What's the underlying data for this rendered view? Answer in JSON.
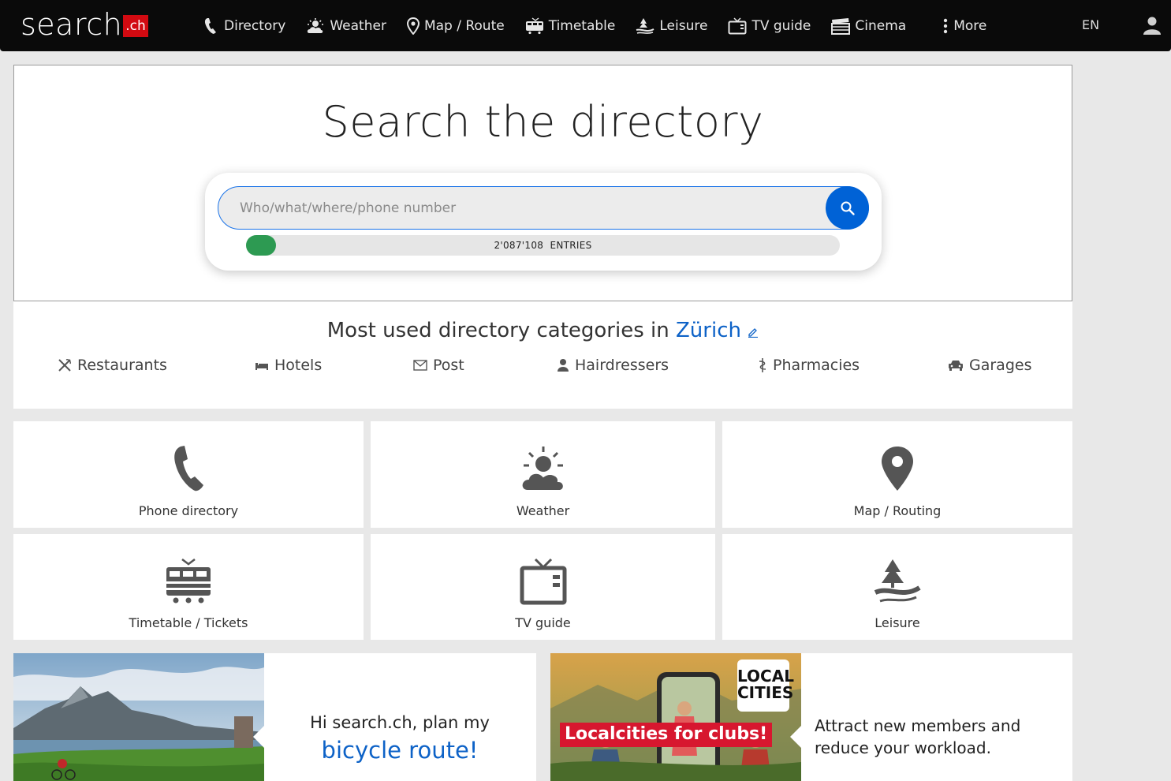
{
  "header": {
    "logo_text": "search",
    "logo_suffix": ".ch",
    "nav": [
      {
        "label": "Directory",
        "icon": "phone-icon"
      },
      {
        "label": "Weather",
        "icon": "weather-icon"
      },
      {
        "label": "Map / Route",
        "icon": "map-pin-icon"
      },
      {
        "label": "Timetable",
        "icon": "train-icon"
      },
      {
        "label": "Leisure",
        "icon": "leisure-icon"
      },
      {
        "label": "TV guide",
        "icon": "tv-icon"
      },
      {
        "label": "Cinema",
        "icon": "clapper-icon"
      },
      {
        "label": "More",
        "icon": "more-dots-icon"
      }
    ],
    "language": "EN",
    "user_icon": "user-icon"
  },
  "hero": {
    "title": "Search the directory",
    "search_placeholder": "Who/what/where/phone number",
    "entries_count": "2'087'108",
    "entries_label": "ENTRIES",
    "progress_fraction": 0.05,
    "accent_color": "#0062d6",
    "progress_color": "#2d9a52"
  },
  "categories": {
    "title_prefix": "Most used directory categories in",
    "city": "Zürich",
    "items": [
      {
        "label": "Restaurants",
        "icon": "cutlery-icon"
      },
      {
        "label": "Hotels",
        "icon": "bed-icon"
      },
      {
        "label": "Post",
        "icon": "envelope-icon"
      },
      {
        "label": "Hairdressers",
        "icon": "person-icon"
      },
      {
        "label": "Pharmacies",
        "icon": "caduceus-icon"
      },
      {
        "label": "Garages",
        "icon": "car-icon"
      }
    ]
  },
  "tiles": [
    {
      "label": "Phone directory",
      "icon": "phone-icon"
    },
    {
      "label": "Weather",
      "icon": "weather-icon"
    },
    {
      "label": "Map / Routing",
      "icon": "map-pin-icon"
    },
    {
      "label": "Timetable / Tickets",
      "icon": "train-icon"
    },
    {
      "label": "TV guide",
      "icon": "tv-icon"
    },
    {
      "label": "Leisure",
      "icon": "leisure-icon"
    }
  ],
  "promos": [
    {
      "line1": "Hi search.ch, plan my",
      "line2": "bicycle route!"
    },
    {
      "banner": "Localcities for clubs!",
      "logo_line1": "LOCAL",
      "logo_line2": "CITIES",
      "text": "Attract new members and reduce your workload."
    }
  ]
}
